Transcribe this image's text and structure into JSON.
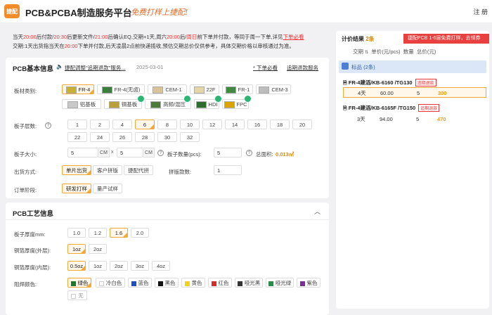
{
  "topbar": {
    "logo": "捷配",
    "brand": "PCB&PCBA制造服务平台",
    "slogan": "免费打样上捷配!",
    "nav": "注 册"
  },
  "notice": {
    "line1_a": "当天",
    "t1": "20:00",
    "line1_b": "后付款/",
    "t2": "20:30",
    "line1_c": "后更新文件/",
    "t3": "21:00",
    "line1_d": "后确认EQ,交期+1天,周六",
    "t4": "20:00",
    "line1_e": "后/",
    "t5": "周日",
    "line1_f": "前下单并付款，等同于周一下单,详见",
    "link": "下单必看",
    "line2_a": "交期:1天出货指当天在",
    "t6": "20:00",
    "line2_b": "下单并付款,后天凌晨2点前快递揽收,预估交期总价仅供参考，具体交期价格以审核通过为准。"
  },
  "pcb_basic": {
    "title": "PCB基本信息",
    "links": [
      "捷配调整\"追期退款\"服务...",
      "2025-03-01",
      "* 下单必看",
      "追期退款服务"
    ],
    "board_type": {
      "label": "板材类别:",
      "options": [
        "FR-4",
        "FR-4(无卤)",
        "CEM-1",
        "22F",
        "FR-1",
        "CEM-3",
        "铝基板",
        "铜基板",
        "高频/混压",
        "HDI",
        "FPC"
      ],
      "selected": "FR-4"
    },
    "layers": {
      "label": "板子层数:",
      "options": [
        "1",
        "2",
        "4",
        "6",
        "8",
        "10",
        "12",
        "14",
        "16",
        "18",
        "20",
        "22",
        "24",
        "26",
        "28",
        "30",
        "32"
      ],
      "selected": "6"
    },
    "size": {
      "label": "板子大小:",
      "w": "5",
      "h": "5",
      "unit": "CM",
      "sep": "x",
      "qty_label": "板子数量(pcs):",
      "qty": "5",
      "area_label": "总面积:",
      "area": "0.013㎡"
    },
    "ship": {
      "label": "出货方式:",
      "options": [
        "单片出货",
        "客户拼版",
        "捷配代拼"
      ],
      "selected": "单片出货",
      "panel_label": "拼版款数:",
      "panel": "1"
    },
    "order": {
      "label": "订单阶段:",
      "options": [
        "研发打样",
        "量产试样"
      ],
      "selected": "研发打样"
    }
  },
  "pcb_process": {
    "title": "PCB工艺信息",
    "thickness": {
      "label": "板子厚度mm:",
      "options": [
        "1.0",
        "1.2",
        "1.6",
        "2.0"
      ],
      "selected": "1.6"
    },
    "outer_cu": {
      "label": "铜箔厚度(外层):",
      "options": [
        "1oz",
        "2oz"
      ],
      "selected": "1oz"
    },
    "inner_cu": {
      "label": "铜箔厚度(内层):",
      "options": [
        "0.5oz",
        "1oz",
        "2oz",
        "3oz",
        "4oz"
      ],
      "selected": "0.5oz"
    },
    "mask": {
      "label": "阻焊颜色:",
      "options": [
        {
          "name": "绿色",
          "color": "#1a7a2a"
        },
        {
          "name": "冷白色",
          "color": "#ffffff"
        },
        {
          "name": "蓝色",
          "color": "#1e4fc2"
        },
        {
          "name": "黑色",
          "color": "#111111"
        },
        {
          "name": "黄色",
          "color": "#f2d21b"
        },
        {
          "name": "红色",
          "color": "#d62b2b"
        },
        {
          "name": "哑光黑",
          "color": "#333333"
        },
        {
          "name": "哑光绿",
          "color": "#2d8a4a"
        },
        {
          "name": "紫色",
          "color": "#7a2f9a"
        }
      ],
      "extra": "无",
      "selected": "绿色"
    }
  },
  "quote": {
    "title": "计价结果",
    "count": "2条",
    "promo": "捷配PCB 1-6层免费打样，去领券",
    "columns": [
      "交期",
      "单价(元/pcs)",
      "数量",
      "总价(元)"
    ],
    "band": "标品 (2条)",
    "items": [
      {
        "name": "FR-4建滔/KB-6160 /TG130",
        "tag": "追期退款",
        "days": "4天",
        "unit": "60.00",
        "qty": "5",
        "total": "300"
      },
      {
        "name": "FR-4建滔/KB-6165F /TG150",
        "tag": "追期退款",
        "days": "3天",
        "unit": "94.00",
        "qty": "5",
        "total": "470"
      }
    ]
  }
}
